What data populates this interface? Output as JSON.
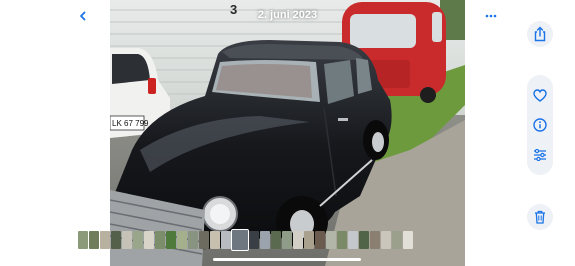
{
  "header": {
    "date": "2. juni 2023",
    "back_icon": "chevron-left-icon",
    "more_icon": "ellipsis-icon"
  },
  "photo": {
    "plate_text": "LK 67 799",
    "sign_number": "3"
  },
  "toolbar": {
    "share_icon": "share-icon",
    "favorite_icon": "heart-icon",
    "info_icon": "info-icon",
    "adjust_icon": "sliders-icon",
    "delete_icon": "trash-icon"
  },
  "colors": {
    "accent": "#1a73e8",
    "button_bg": "#eef1f5"
  },
  "thumbnails": [
    "#8d9a7a",
    "#6f7d5a",
    "#b9b1a0",
    "#55604a",
    "#c6c2b8",
    "#9aa68a",
    "#d8d4c8",
    "#7c8f6a",
    "#4e7a3c",
    "#a4b08c",
    "#889480",
    "#6d6a60",
    "#c7c0ae",
    "#b8bcc0",
    "#6e7680",
    "#3a3f45",
    "#9ba4ac",
    "#5a6a4e",
    "#8e9c88",
    "#d2cfc6",
    "#a9a08e",
    "#6b5a4e",
    "#b2b6a8",
    "#7a8a66",
    "#c4c8cc",
    "#526448",
    "#8a7f70",
    "#cac6bc",
    "#9aa08c",
    "#e2dfd8"
  ],
  "current_thumb_index": 14
}
